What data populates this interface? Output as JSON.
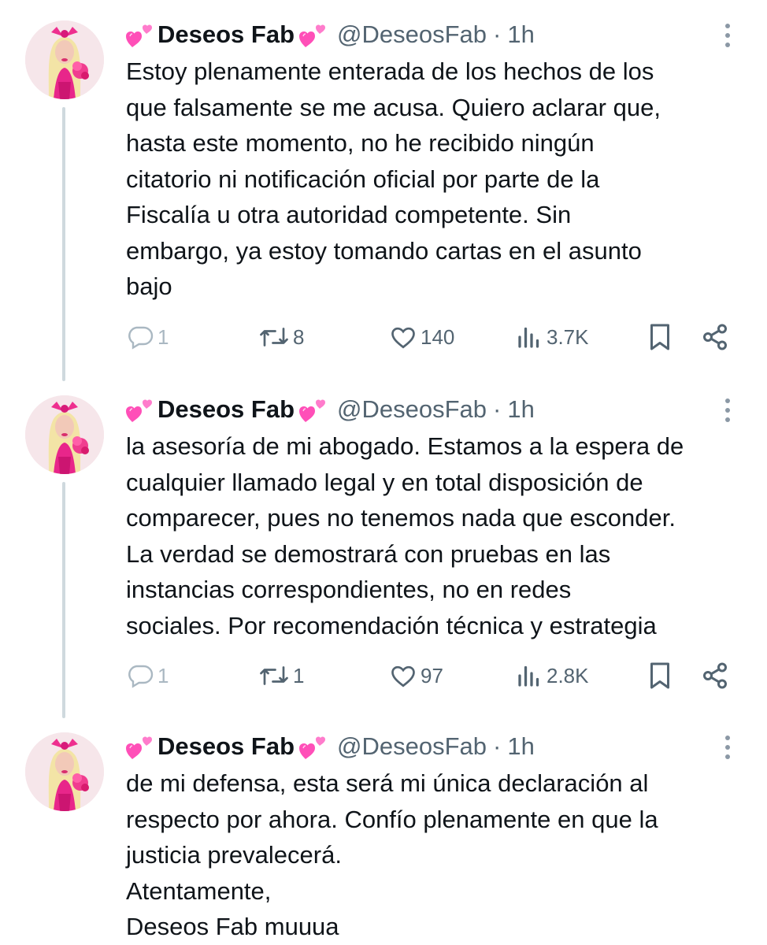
{
  "tweets": [
    {
      "display_name": "Deseos Fab",
      "handle": "@DeseosFab",
      "separator": "·",
      "time": "1h",
      "lines": [
        "Estoy plenamente enterada de los hechos de los",
        "que falsamente se me acusa. Quiero aclarar que,",
        "hasta este momento, no he recibido ningún",
        "citatorio ni notificación oficial por parte de la",
        "Fiscalía u otra autoridad competente. Sin",
        "embargo, ya estoy tomando cartas en el asunto",
        "bajo"
      ],
      "metrics": {
        "replies": "1",
        "retweets": "8",
        "likes": "140",
        "views": "3.7K"
      }
    },
    {
      "display_name": "Deseos Fab",
      "handle": "@DeseosFab",
      "separator": "·",
      "time": "1h",
      "lines": [
        "la asesoría de mi abogado. Estamos a la espera de",
        "cualquier llamado legal y en total disposición de",
        "comparecer, pues no tenemos nada que esconder.",
        "La verdad se demostrará con pruebas en las",
        "instancias correspondientes, no en redes",
        "sociales. Por recomendación técnica y estrategia"
      ],
      "metrics": {
        "replies": "1",
        "retweets": "1",
        "likes": "97",
        "views": "2.8K"
      }
    },
    {
      "display_name": "Deseos Fab",
      "handle": "@DeseosFab",
      "separator": "·",
      "time": "1h",
      "lines": [
        "de mi defensa, esta será mi única declaración al",
        "respecto por ahora. Confío plenamente en que la",
        "justicia prevalecerá.",
        "Atentamente,",
        "Deseos Fab muuua"
      ]
    }
  ],
  "icons": {
    "name_emoji": "two-hearts-icon",
    "more": "more-vertical-icon",
    "reply": "reply-icon",
    "retweet": "retweet-icon",
    "like": "heart-outline-icon",
    "views": "views-chart-icon",
    "bookmark": "bookmark-icon",
    "share": "share-icon"
  },
  "colors": {
    "text": "#0f1419",
    "secondary": "#536471",
    "thread_line": "#cfd9de",
    "heart_emoji": "#ff4fb8"
  }
}
